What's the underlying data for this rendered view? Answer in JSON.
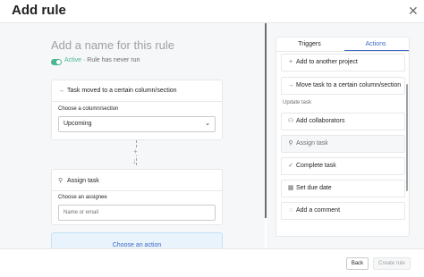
{
  "header": {
    "title": "Add rule",
    "close_icon": "close-icon"
  },
  "rule": {
    "name_placeholder": "Add a name for this rule",
    "status_active": "Active",
    "status_separator": " · ",
    "status_text": "Rule has never run",
    "toggle_on": true
  },
  "trigger_card": {
    "title": "Task moved to a certain column/section",
    "icon": "arrow-right-icon",
    "field_label": "Choose a column/section",
    "select_value": "Upcoming",
    "chevron": "⌄"
  },
  "connector": {
    "plus": "+",
    "arrow": "↓"
  },
  "action_card": {
    "title": "Assign task",
    "icon": "person-icon",
    "field_label": "Choose an assignee",
    "input_placeholder": "Name or email"
  },
  "choose_action": "Choose an action",
  "panel": {
    "tabs": [
      {
        "label": "Triggers",
        "active": false
      },
      {
        "label": "Actions",
        "active": true
      }
    ],
    "items_top": [
      {
        "icon": "plus-icon",
        "glyph": "+",
        "label": "Add to another project"
      },
      {
        "icon": "arrow-right-icon",
        "glyph": "→",
        "label": "Move task to a certain column/section"
      }
    ],
    "section_label": "Update task",
    "items_update": [
      {
        "icon": "collaborators-icon",
        "glyph": "⚇",
        "label": "Add collaborators",
        "muted": false
      },
      {
        "icon": "person-icon",
        "glyph": "⚲",
        "label": "Assign task",
        "muted": true
      },
      {
        "icon": "check-circle-icon",
        "glyph": "✓",
        "label": "Complete task",
        "muted": false
      },
      {
        "icon": "calendar-icon",
        "glyph": "▦",
        "label": "Set due date",
        "muted": false
      },
      {
        "icon": "comment-icon",
        "glyph": "◌",
        "label": "Add a comment",
        "muted": false
      }
    ]
  },
  "footer": {
    "back": "Back",
    "create": "Create rule"
  },
  "colors": {
    "accent": "#3f6ac4",
    "active_green": "#4ab58e",
    "background": "#f6f7f8"
  }
}
